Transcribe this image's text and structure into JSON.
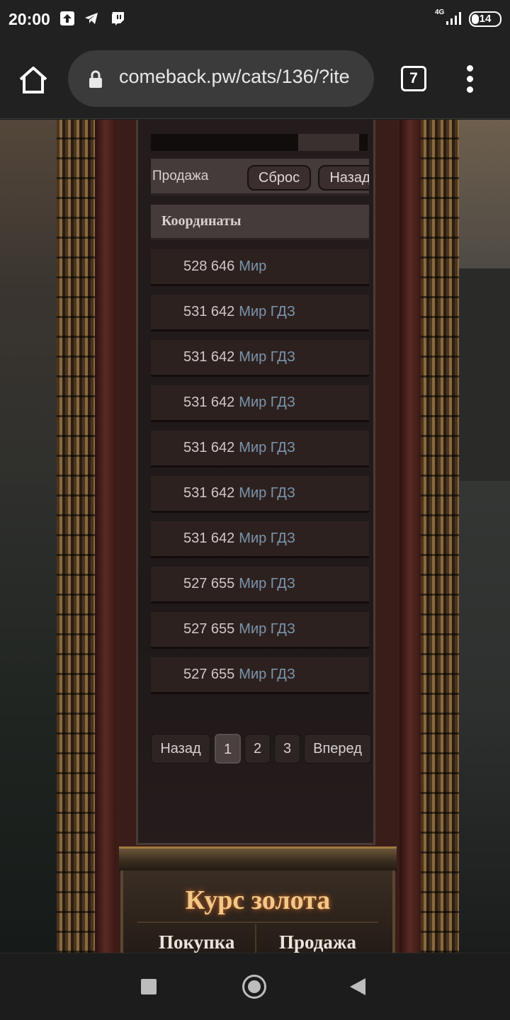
{
  "status_bar": {
    "time": "20:00",
    "network": "4G",
    "battery": "14",
    "icons": [
      "upload-icon",
      "telegram-icon",
      "twitch-icon",
      "signal-icon",
      "battery-icon"
    ]
  },
  "browser": {
    "url": "comeback.pw/cats/136/?ite",
    "tab_count": "7"
  },
  "page": {
    "filter": {
      "label": "Продажа",
      "reset_label": "Сброс",
      "back_label": "Назад"
    },
    "table_header": "Координаты",
    "rows": [
      {
        "coords": "528 646",
        "world": "Мир"
      },
      {
        "coords": "531 642",
        "world": "Мир ГДЗ"
      },
      {
        "coords": "531 642",
        "world": "Мир ГДЗ"
      },
      {
        "coords": "531 642",
        "world": "Мир ГДЗ"
      },
      {
        "coords": "531 642",
        "world": "Мир ГДЗ"
      },
      {
        "coords": "531 642",
        "world": "Мир ГДЗ"
      },
      {
        "coords": "531 642",
        "world": "Мир ГДЗ"
      },
      {
        "coords": "527 655",
        "world": "Мир ГДЗ"
      },
      {
        "coords": "527 655",
        "world": "Мир ГДЗ"
      },
      {
        "coords": "527 655",
        "world": "Мир ГДЗ"
      }
    ],
    "pagination": {
      "prev": "Назад",
      "pages": [
        "1",
        "2",
        "3"
      ],
      "current": "1",
      "next": "Вперед"
    },
    "gold_rate": {
      "title": "Курс золота",
      "buy": "Покупка",
      "sell": "Продажа"
    }
  },
  "colors": {
    "world_link": "#7a95aa",
    "gold_title": "#f0c98a"
  }
}
